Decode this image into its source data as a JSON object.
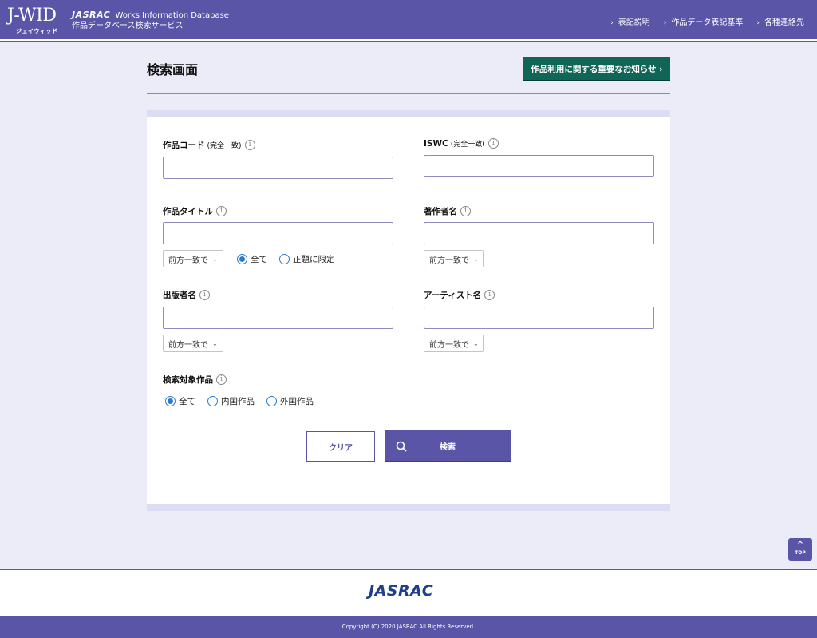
{
  "header": {
    "logo_text": "J-WID",
    "logo_sub": "ジェイウィッド",
    "brand_name": "JASRAC",
    "brand_tagline": "Works Information Database",
    "brand_subtitle": "作品データベース検索サービス",
    "nav": [
      {
        "label": "表記説明"
      },
      {
        "label": "作品データ表記基準"
      },
      {
        "label": "各種連絡先"
      }
    ]
  },
  "page": {
    "title": "検索画面",
    "notice_button": "作品利用に関する重要なお知らせ ›"
  },
  "form": {
    "work_code": {
      "label": "作品コード",
      "note": "(完全一致)",
      "value": ""
    },
    "iswc": {
      "label": "ISWC",
      "note": "(完全一致)",
      "value": ""
    },
    "work_title": {
      "label": "作品タイトル",
      "value": "",
      "match": "前方一致で",
      "scope_options": [
        {
          "label": "全て",
          "selected": true
        },
        {
          "label": "正題に限定",
          "selected": false
        }
      ]
    },
    "author": {
      "label": "著作者名",
      "value": "",
      "match": "前方一致で"
    },
    "publisher": {
      "label": "出版者名",
      "value": "",
      "match": "前方一致で"
    },
    "artist": {
      "label": "アーティスト名",
      "value": "",
      "match": "前方一致で"
    },
    "target": {
      "label": "検索対象作品",
      "options": [
        {
          "label": "全て",
          "selected": true
        },
        {
          "label": "内国作品",
          "selected": false
        },
        {
          "label": "外国作品",
          "selected": false
        }
      ]
    },
    "clear_button": "クリア",
    "search_button": "検索"
  },
  "top_button": "TOP",
  "footer": {
    "logo": "JASRAC",
    "copyright": "Copyright (C) 2020 JASRAC All Rights Reserved."
  },
  "colors": {
    "primary": "#5a55a7",
    "notice": "#0f6656",
    "background": "#ececf8",
    "radio_accent": "#2c7bc8",
    "footer_logo": "#1f3f8e"
  }
}
